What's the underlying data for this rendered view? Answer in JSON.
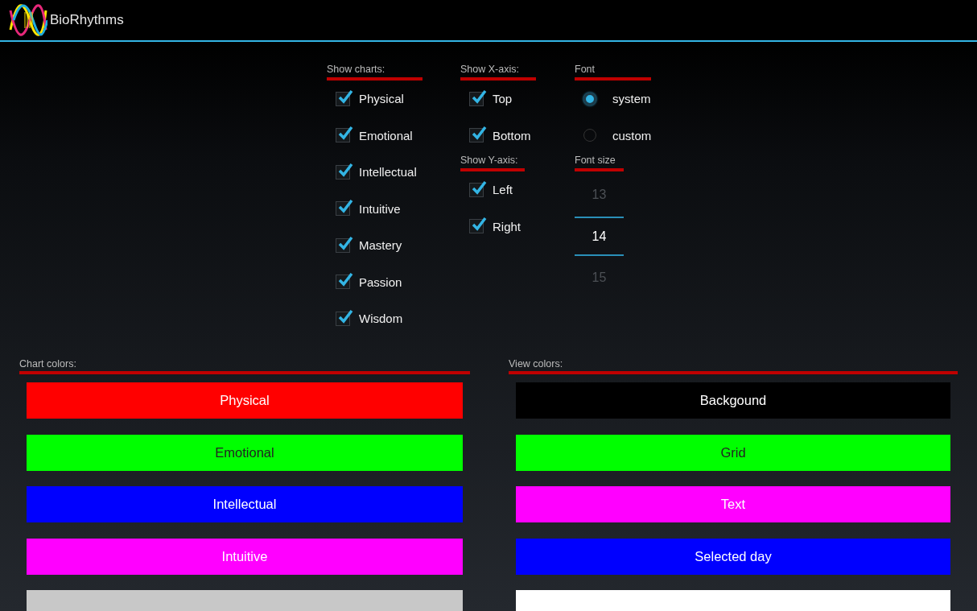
{
  "app_bar": {
    "title": "BioRhythms"
  },
  "show_charts": {
    "label": "Show charts:",
    "items": [
      {
        "label": "Physical",
        "checked": true
      },
      {
        "label": "Emotional",
        "checked": true
      },
      {
        "label": "Intellectual",
        "checked": true
      },
      {
        "label": "Intuitive",
        "checked": true
      },
      {
        "label": "Mastery",
        "checked": true
      },
      {
        "label": "Passion",
        "checked": true
      },
      {
        "label": "Wisdom",
        "checked": true
      }
    ]
  },
  "show_x_axis": {
    "label": "Show X-axis:",
    "items": [
      {
        "label": "Top",
        "checked": true
      },
      {
        "label": "Bottom",
        "checked": true
      }
    ]
  },
  "show_y_axis": {
    "label": "Show Y-axis:",
    "items": [
      {
        "label": "Left",
        "checked": true
      },
      {
        "label": "Right",
        "checked": true
      }
    ]
  },
  "font": {
    "label": "Font",
    "options": [
      {
        "label": "system",
        "selected": true
      },
      {
        "label": "custom",
        "selected": false
      }
    ]
  },
  "font_size": {
    "label": "Font size",
    "options": [
      {
        "label": "13",
        "selected": false
      },
      {
        "label": "14",
        "selected": true
      },
      {
        "label": "15",
        "selected": false
      }
    ]
  },
  "chart_colors": {
    "label": "Chart colors:",
    "buttons": [
      {
        "label": "Physical",
        "color": "#ff0000"
      },
      {
        "label": "Emotional",
        "color": "#00ff00"
      },
      {
        "label": "Intellectual",
        "color": "#0000ff"
      },
      {
        "label": "Intuitive",
        "color": "#ff00ff"
      },
      {
        "color": "#c8c8c8"
      }
    ]
  },
  "view_colors": {
    "label": "View colors:",
    "buttons": [
      {
        "label": "Backgound",
        "color": "#000000"
      },
      {
        "label": "Grid",
        "color": "#00ff00"
      },
      {
        "label": "Text",
        "color": "#ff00ff"
      },
      {
        "label": "Selected day",
        "color": "#0000ff"
      },
      {
        "color": "#ffffff"
      }
    ]
  }
}
